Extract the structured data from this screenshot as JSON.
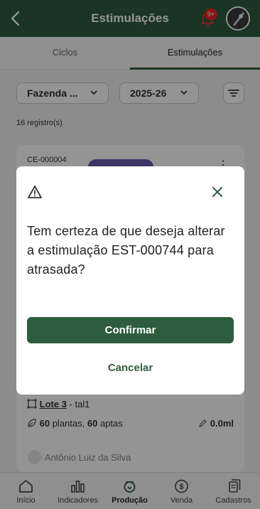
{
  "header": {
    "title": "Estimulações",
    "notification_badge": "9+"
  },
  "tabs": [
    {
      "label": "Ciclos",
      "active": false
    },
    {
      "label": "Estimulações",
      "active": true
    }
  ],
  "filters": {
    "farm": "Fazenda ...",
    "season": "2025-26"
  },
  "records_count": "16 registro(s)",
  "card": {
    "code": "CE-000004",
    "lot_link": "Lote 3",
    "lot_suffix": " - tal1",
    "plants_count": "60",
    "plants_label": " plantas, ",
    "apt_count": "60",
    "apt_label": " aptas",
    "volume": "0.0ml",
    "person": "Antônio Luiz da Silva"
  },
  "dialog": {
    "message": "Tem certeza de que deseja alterar a estimulação EST-000744 para atrasada?",
    "confirm_label": "Confirmar",
    "cancel_label": "Cancelar"
  },
  "nav": [
    {
      "label": "Início",
      "icon": "home-icon"
    },
    {
      "label": "Indicadores",
      "icon": "bar-chart-icon"
    },
    {
      "label": "Produção",
      "icon": "production-icon",
      "active": true
    },
    {
      "label": "Venda",
      "icon": "dollar-icon"
    },
    {
      "label": "Cadastros",
      "icon": "copy-icon"
    }
  ],
  "colors": {
    "primary": "#2e5c3f",
    "badge": "#e22222",
    "chip": "#6b5bb0"
  }
}
